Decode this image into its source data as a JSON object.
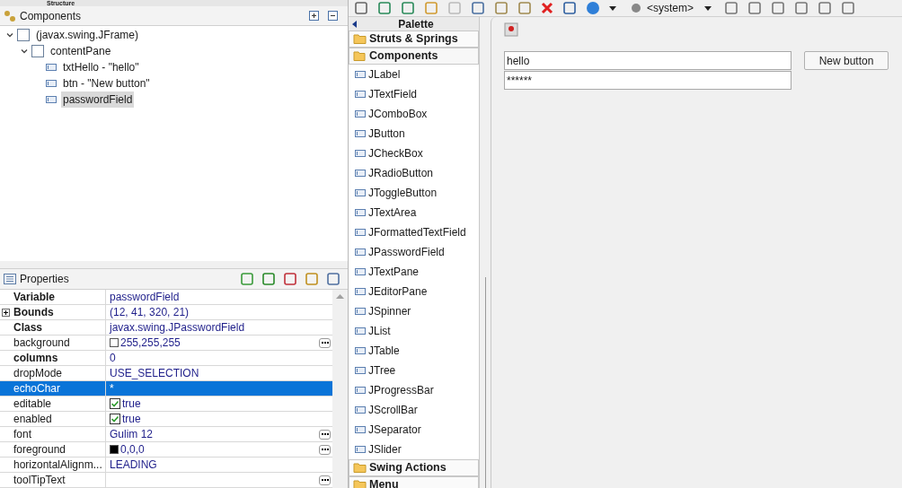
{
  "structure_tab": {
    "title": "Structure"
  },
  "components": {
    "title": "Components",
    "tree": [
      {
        "label": "(javax.swing.JFrame)",
        "expanded": true,
        "selected": false,
        "children": [
          {
            "label": "contentPane",
            "expanded": true,
            "selected": false,
            "children": [
              {
                "label": "txtHello - \"hello\"",
                "selected": false
              },
              {
                "label": "btn - \"New button\"",
                "selected": false
              },
              {
                "label": "passwordField",
                "selected": true
              }
            ]
          }
        ]
      }
    ]
  },
  "properties": {
    "title": "Properties",
    "rows": [
      {
        "name": "Variable",
        "value": "passwordField",
        "bold": true,
        "kind": "text",
        "selected": false
      },
      {
        "name": "Bounds",
        "value": "(12, 41, 320, 21)",
        "bold": true,
        "kind": "expandable",
        "selected": false
      },
      {
        "name": "Class",
        "value": "javax.swing.JPasswordField",
        "bold": true,
        "kind": "text",
        "selected": false
      },
      {
        "name": "background",
        "value": "255,255,255",
        "bold": false,
        "kind": "swatch",
        "ellipsis": true,
        "selected": false
      },
      {
        "name": "columns",
        "value": "0",
        "bold": true,
        "kind": "text",
        "selected": false
      },
      {
        "name": "dropMode",
        "value": "USE_SELECTION",
        "bold": false,
        "kind": "text",
        "selected": false
      },
      {
        "name": "echoChar",
        "value": "*",
        "bold": false,
        "kind": "text",
        "selected": true
      },
      {
        "name": "editable",
        "value": "true",
        "bold": false,
        "kind": "checkbox",
        "checked": true,
        "selected": false
      },
      {
        "name": "enabled",
        "value": "true",
        "bold": false,
        "kind": "checkbox",
        "checked": true,
        "selected": false
      },
      {
        "name": "font",
        "value": "Gulim 12",
        "bold": false,
        "kind": "text",
        "ellipsis": true,
        "selected": false
      },
      {
        "name": "foreground",
        "value": "0,0,0",
        "bold": false,
        "kind": "swatch",
        "ellipsis": true,
        "selected": false
      },
      {
        "name": "horizontalAlignm...",
        "value": "LEADING",
        "bold": false,
        "kind": "text",
        "selected": false
      },
      {
        "name": "toolTipText",
        "bold": false,
        "kind": "text",
        "ellipsis": true,
        "selected": false
      }
    ]
  },
  "toolbar": {
    "dropdown": "<system>"
  },
  "palette": {
    "title": "Palette",
    "groups": [
      {
        "label": "Struts & Springs",
        "expanded": false
      },
      {
        "label": "Components",
        "expanded": true,
        "items": [
          "JLabel",
          "JTextField",
          "JComboBox",
          "JButton",
          "JCheckBox",
          "JRadioButton",
          "JToggleButton",
          "JTextArea",
          "JFormattedTextField",
          "JPasswordField",
          "JTextPane",
          "JEditorPane",
          "JSpinner",
          "JList",
          "JTable",
          "JTree",
          "JProgressBar",
          "JScrollBar",
          "JSeparator",
          "JSlider"
        ]
      },
      {
        "label": "Swing Actions",
        "expanded": false
      },
      {
        "label": "Menu",
        "expanded": false
      }
    ]
  },
  "canvas": {
    "text_field": "hello",
    "button": "New button",
    "password_field": "******"
  }
}
